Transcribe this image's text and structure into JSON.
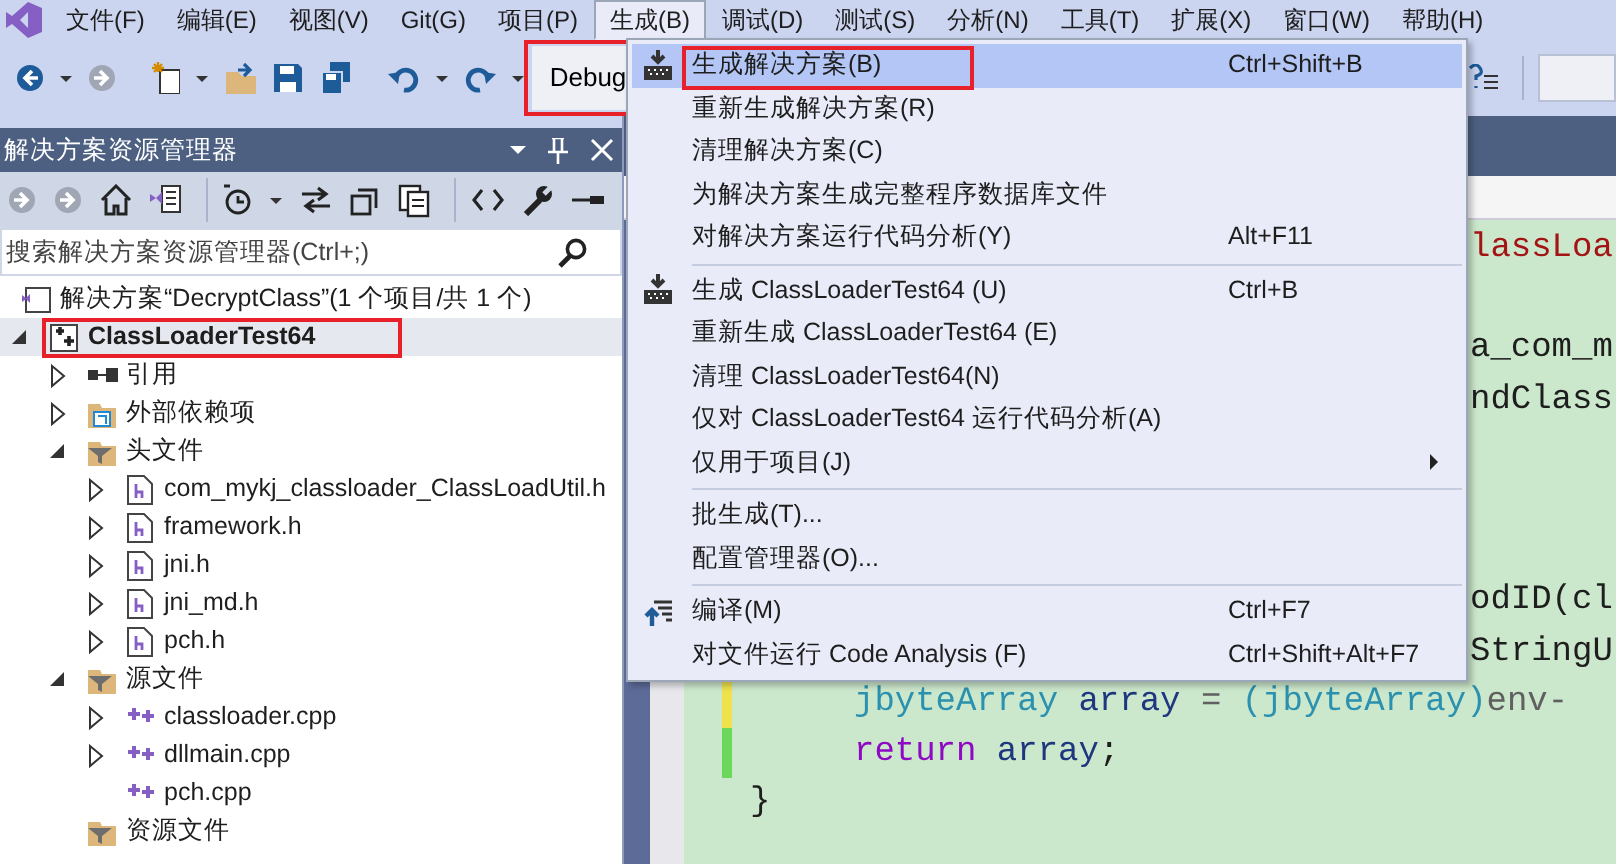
{
  "menu_bar": [
    {
      "label": "文件(F)",
      "selected": false
    },
    {
      "label": "编辑(E)",
      "selected": false
    },
    {
      "label": "视图(V)",
      "selected": false
    },
    {
      "label": "Git(G)",
      "selected": false
    },
    {
      "label": "项目(P)",
      "selected": false
    },
    {
      "label": "生成(B)",
      "selected": true
    },
    {
      "label": "调试(D)",
      "selected": false
    },
    {
      "label": "测试(S)",
      "selected": false
    },
    {
      "label": "分析(N)",
      "selected": false
    },
    {
      "label": "工具(T)",
      "selected": false
    },
    {
      "label": "扩展(X)",
      "selected": false
    },
    {
      "label": "窗口(W)",
      "selected": false
    },
    {
      "label": "帮助(H)",
      "selected": false
    }
  ],
  "toolbar": {
    "configuration": {
      "value": "Debug",
      "annotated": true
    }
  },
  "solution_explorer": {
    "title": "解决方案资源管理器",
    "search": {
      "placeholder": "搜索解决方案资源管理器(Ctrl+;)"
    },
    "tree": [
      {
        "label": "解决方案“DecryptClass”(1 个项目/共 1 个)",
        "kind": "solution",
        "selected": false,
        "children": [
          {
            "label": "ClassLoaderTest64",
            "kind": "project",
            "expanded": true,
            "selected": true,
            "annotated": true,
            "children": [
              {
                "label": "引用",
                "kind": "references",
                "expanded": false,
                "selected": false
              },
              {
                "label": "外部依赖项",
                "kind": "external",
                "expanded": false,
                "selected": false
              },
              {
                "label": "头文件",
                "kind": "filter",
                "expanded": true,
                "selected": false,
                "children": [
                  {
                    "label": "com_mykj_classloader_ClassLoadUtil.h",
                    "kind": "header",
                    "expanded": false,
                    "selected": false
                  },
                  {
                    "label": "framework.h",
                    "kind": "header",
                    "expanded": false,
                    "selected": false
                  },
                  {
                    "label": "jni.h",
                    "kind": "header",
                    "expanded": false,
                    "selected": false
                  },
                  {
                    "label": "jni_md.h",
                    "kind": "header",
                    "expanded": false,
                    "selected": false
                  },
                  {
                    "label": "pch.h",
                    "kind": "header",
                    "expanded": false,
                    "selected": false
                  }
                ]
              },
              {
                "label": "源文件",
                "kind": "filter",
                "expanded": true,
                "selected": false,
                "children": [
                  {
                    "label": "classloader.cpp",
                    "kind": "source",
                    "expanded": false,
                    "selected": false
                  },
                  {
                    "label": "dllmain.cpp",
                    "kind": "source",
                    "expanded": false,
                    "selected": false
                  },
                  {
                    "label": "pch.cpp",
                    "kind": "source",
                    "selected": false
                  }
                ]
              },
              {
                "label": "资源文件",
                "kind": "filter",
                "selected": false
              }
            ]
          }
        ]
      }
    ]
  },
  "build_menu": [
    {
      "kind": "build",
      "label": "生成解决方案(B)",
      "shortcut": "Ctrl+Shift+B",
      "selected": true,
      "annotated": true
    },
    {
      "kind": "item",
      "label": "重新生成解决方案(R)",
      "selected": false
    },
    {
      "kind": "item",
      "label": "清理解决方案(C)",
      "selected": false
    },
    {
      "kind": "item",
      "label": "为解决方案生成完整程序数据库文件",
      "selected": false
    },
    {
      "kind": "item",
      "label": "对解决方案运行代码分析(Y)",
      "shortcut": "Alt+F11",
      "selected": false
    },
    {
      "kind": "separator"
    },
    {
      "kind": "build",
      "label": "生成 ClassLoaderTest64 (U)",
      "shortcut": "Ctrl+B",
      "selected": false
    },
    {
      "kind": "item",
      "label": "重新生成 ClassLoaderTest64 (E)",
      "selected": false
    },
    {
      "kind": "item",
      "label": "清理 ClassLoaderTest64(N)",
      "selected": false
    },
    {
      "kind": "item",
      "label": "仅对 ClassLoaderTest64 运行代码分析(A)",
      "selected": false
    },
    {
      "kind": "submenu",
      "label": "仅用于项目(J)",
      "selected": false
    },
    {
      "kind": "separator"
    },
    {
      "kind": "item",
      "label": "批生成(T)...",
      "selected": false
    },
    {
      "kind": "item",
      "label": "配置管理器(O)...",
      "selected": false
    },
    {
      "kind": "separator"
    },
    {
      "kind": "compile",
      "label": "编译(M)",
      "shortcut": "Ctrl+F7",
      "selected": false
    },
    {
      "kind": "item",
      "label": "对文件运行 Code Analysis (F)",
      "shortcut": "Ctrl+Shift+Alt+F7",
      "selected": false
    }
  ],
  "code_lines": [
    {
      "kind": "overlapped",
      "tokens": [
        {
          "kind": "string",
          "text": "lassLoa"
        }
      ]
    },
    {
      "kind": "covered"
    },
    {
      "kind": "overlapped",
      "tokens": [
        {
          "kind": "plain",
          "text": "a_com_m"
        }
      ]
    },
    {
      "kind": "overlapped",
      "tokens": [
        {
          "kind": "plain",
          "text": "ndClass"
        }
      ]
    },
    {
      "kind": "covered"
    },
    {
      "kind": "covered"
    },
    {
      "kind": "covered"
    },
    {
      "kind": "overlapped",
      "tokens": [
        {
          "kind": "plain",
          "text": "odID(cl"
        }
      ]
    },
    {
      "kind": "overlapped",
      "tokens": [
        {
          "kind": "plain",
          "text": "StringU"
        }
      ]
    },
    {
      "kind": "body",
      "saved": false,
      "tokens": [
        {
          "kind": "type",
          "text": "jbyteArray"
        },
        {
          "kind": "variable",
          "text": " array"
        },
        {
          "kind": "operator",
          "text": " = "
        },
        {
          "kind": "type",
          "text": "(jbyteArray)"
        },
        {
          "kind": "operator",
          "text": "env-"
        }
      ]
    },
    {
      "kind": "body",
      "saved": true,
      "tokens": [
        {
          "kind": "keyword",
          "text": "return"
        },
        {
          "kind": "variable",
          "text": " array"
        },
        {
          "kind": "plain",
          "text": ";"
        }
      ]
    },
    {
      "kind": "close",
      "tokens": [
        {
          "kind": "plain",
          "text": "}"
        }
      ]
    }
  ]
}
